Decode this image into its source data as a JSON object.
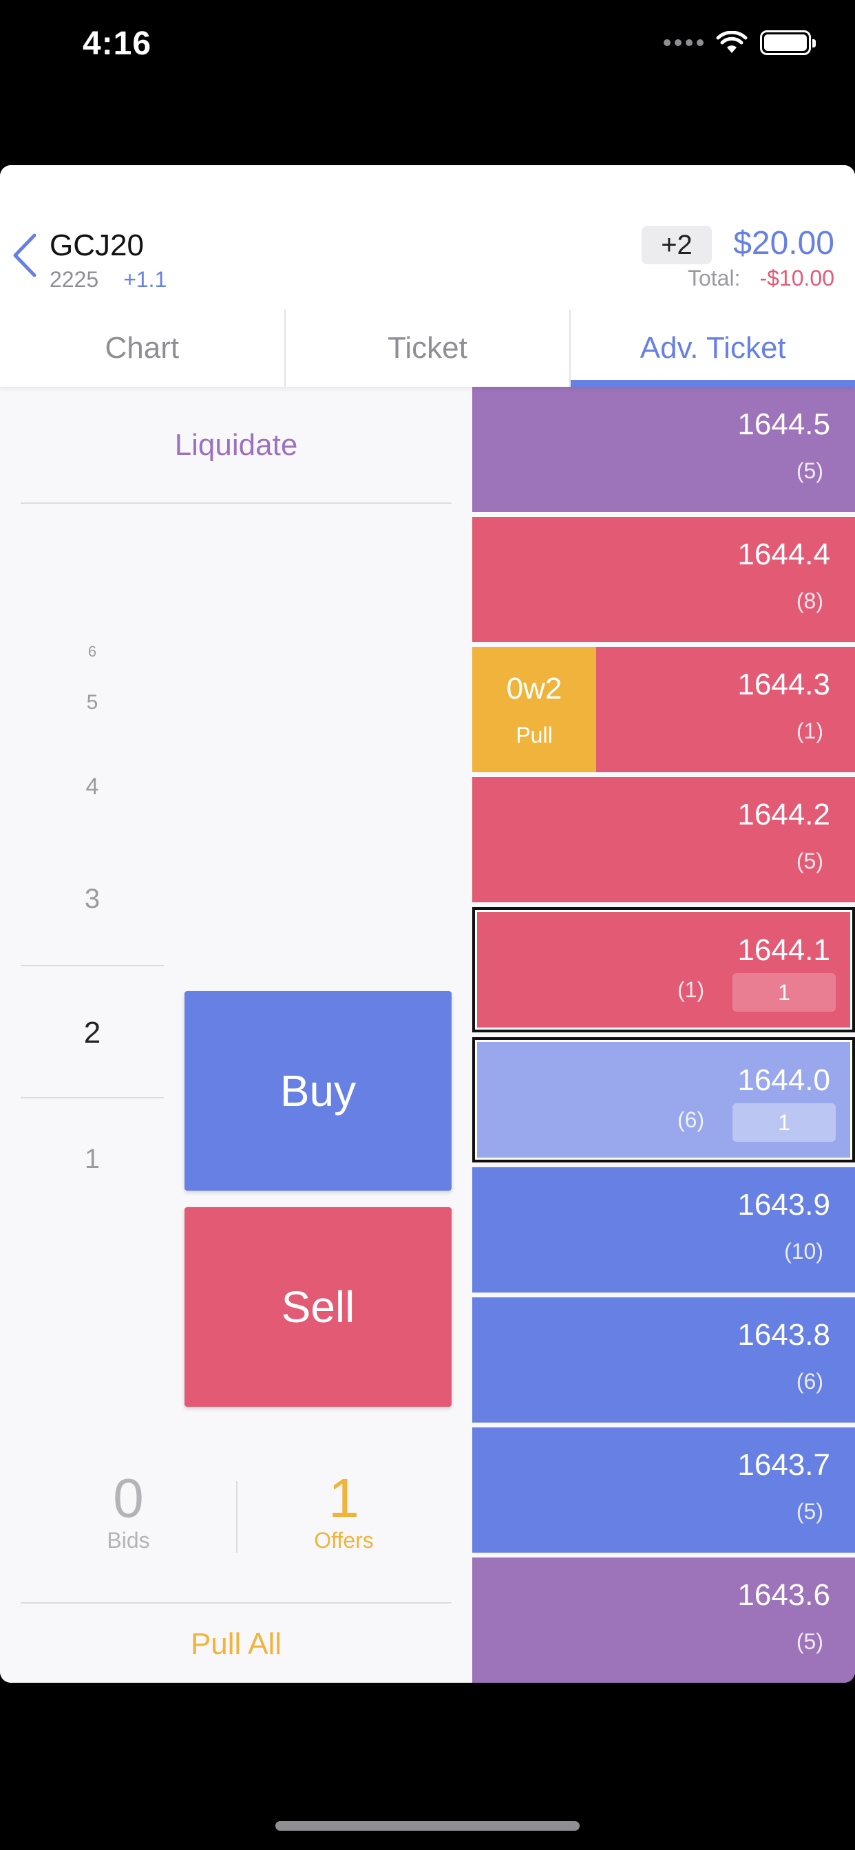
{
  "status_bar": {
    "time": "4:16"
  },
  "header": {
    "symbol": "GCJ20",
    "last": "2225",
    "change": "+1.1",
    "position": "+2",
    "pnl": "$20.00",
    "total_label": "Total:",
    "total_value": "-$10.00"
  },
  "tabs": [
    {
      "label": "Chart"
    },
    {
      "label": "Ticket"
    },
    {
      "label": "Adv. Ticket"
    }
  ],
  "left": {
    "liquidate": "Liquidate",
    "quantities": [
      "6",
      "5",
      "4",
      "3",
      "2",
      "1"
    ],
    "buy": "Buy",
    "sell": "Sell",
    "bids_count": "0",
    "bids_label": "Bids",
    "offers_count": "1",
    "offers_label": "Offers",
    "pull_all": "Pull All"
  },
  "ladder": [
    {
      "price": "1644.5",
      "size": "(5)"
    },
    {
      "price": "1644.4",
      "size": "(8)"
    },
    {
      "price": "1644.3",
      "size": "(1)",
      "pending_order": "0w2",
      "pending_action": "Pull"
    },
    {
      "price": "1644.2",
      "size": "(5)"
    },
    {
      "price": "1644.1",
      "size": "(1)",
      "order_qty": "1"
    },
    {
      "price": "1644.0",
      "size": "(6)",
      "order_qty": "1"
    },
    {
      "price": "1643.9",
      "size": "(10)"
    },
    {
      "price": "1643.8",
      "size": "(6)"
    },
    {
      "price": "1643.7",
      "size": "(5)"
    },
    {
      "price": "1643.6",
      "size": "(5)"
    }
  ],
  "colors": {
    "accent_blue": "#6680e3",
    "ask_red": "#e35a74",
    "purple": "#9d74ba",
    "pending_yellow": "#f0b43c"
  }
}
